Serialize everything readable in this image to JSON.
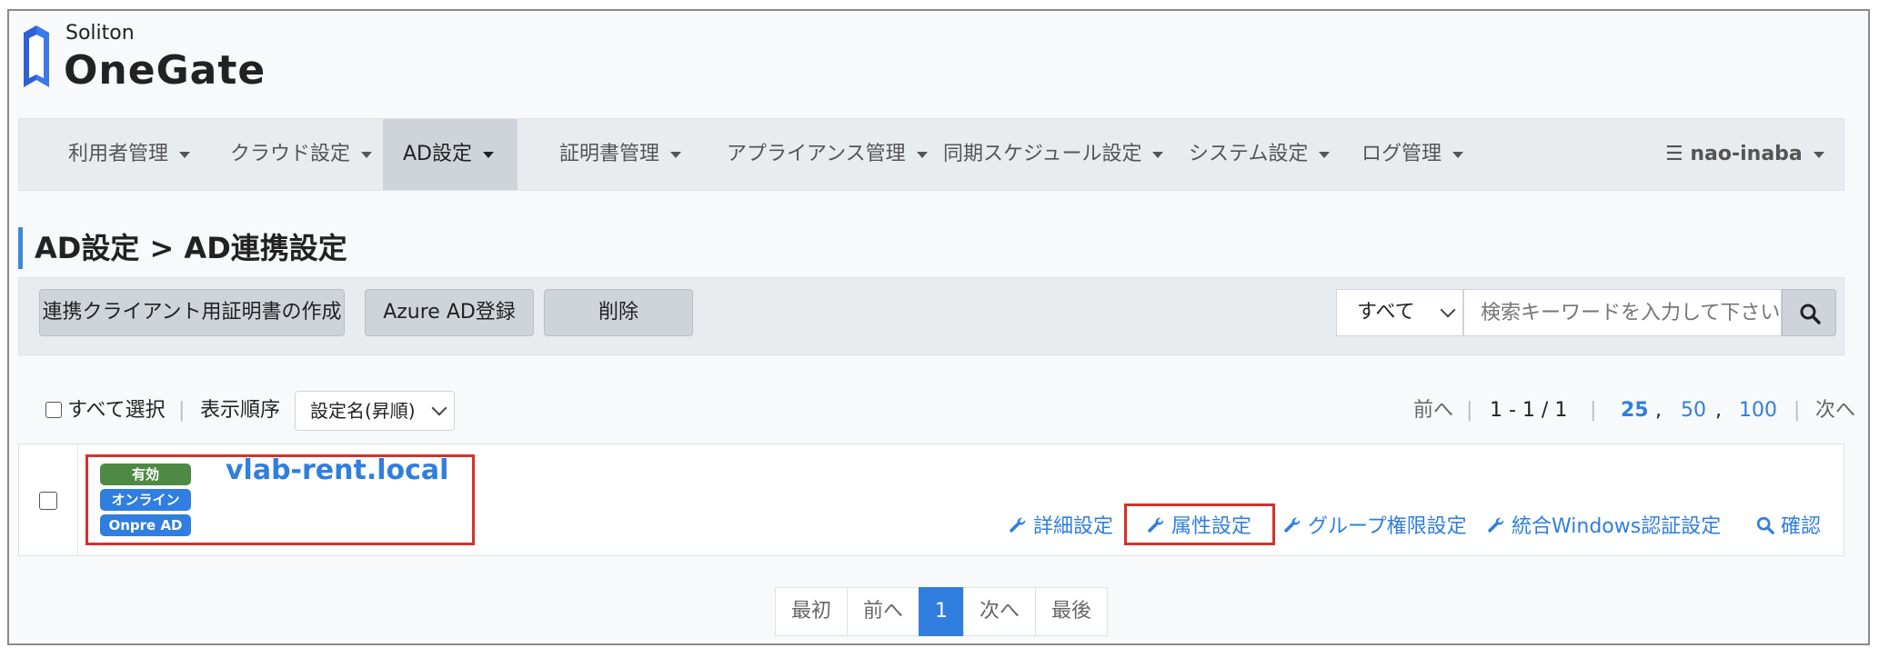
{
  "logo": {
    "brand_small": "Soliton",
    "brand_big": "OneGate"
  },
  "navbar": {
    "items": [
      {
        "label": "利用者管理"
      },
      {
        "label": "クラウド設定"
      },
      {
        "label": "AD設定"
      },
      {
        "label": "証明書管理"
      },
      {
        "label": "アプライアンス管理"
      },
      {
        "label": "同期スケジュール設定"
      },
      {
        "label": "システム設定"
      },
      {
        "label": "ログ管理"
      }
    ],
    "active_index": 2,
    "user": "☰ nao-inaba"
  },
  "page": {
    "title": "AD設定 > AD連携設定"
  },
  "toolbar": {
    "create_cert_label": "連携クライアント用証明書の作成",
    "azure_label": "Azure AD登録",
    "delete_label": "削除",
    "filter_value": "すべて",
    "search_placeholder": "検索キーワードを入力して下さい。"
  },
  "list_controls": {
    "select_all_label": "すべて選択",
    "sort_label": "表示順序",
    "sort_value": "設定名(昇順)",
    "prev_label": "前へ",
    "range": "1 - 1 / 1",
    "page_sizes": [
      "25",
      "50",
      "100"
    ],
    "next_label": "次へ"
  },
  "rows": [
    {
      "badges": [
        "有効",
        "オンライン",
        "Onpre AD"
      ],
      "name": "vlab-rent.local",
      "actions": [
        "詳細設定",
        "属性設定",
        "グループ権限設定",
        "統合Windows認証設定",
        "確認"
      ]
    }
  ],
  "pagination": {
    "first": "最初",
    "prev": "前へ",
    "current": "1",
    "next": "次へ",
    "last": "最後"
  },
  "colors": {
    "accent": "#2f7ee0",
    "active_badge": "#4f8a45",
    "highlight": "#d9302c"
  }
}
